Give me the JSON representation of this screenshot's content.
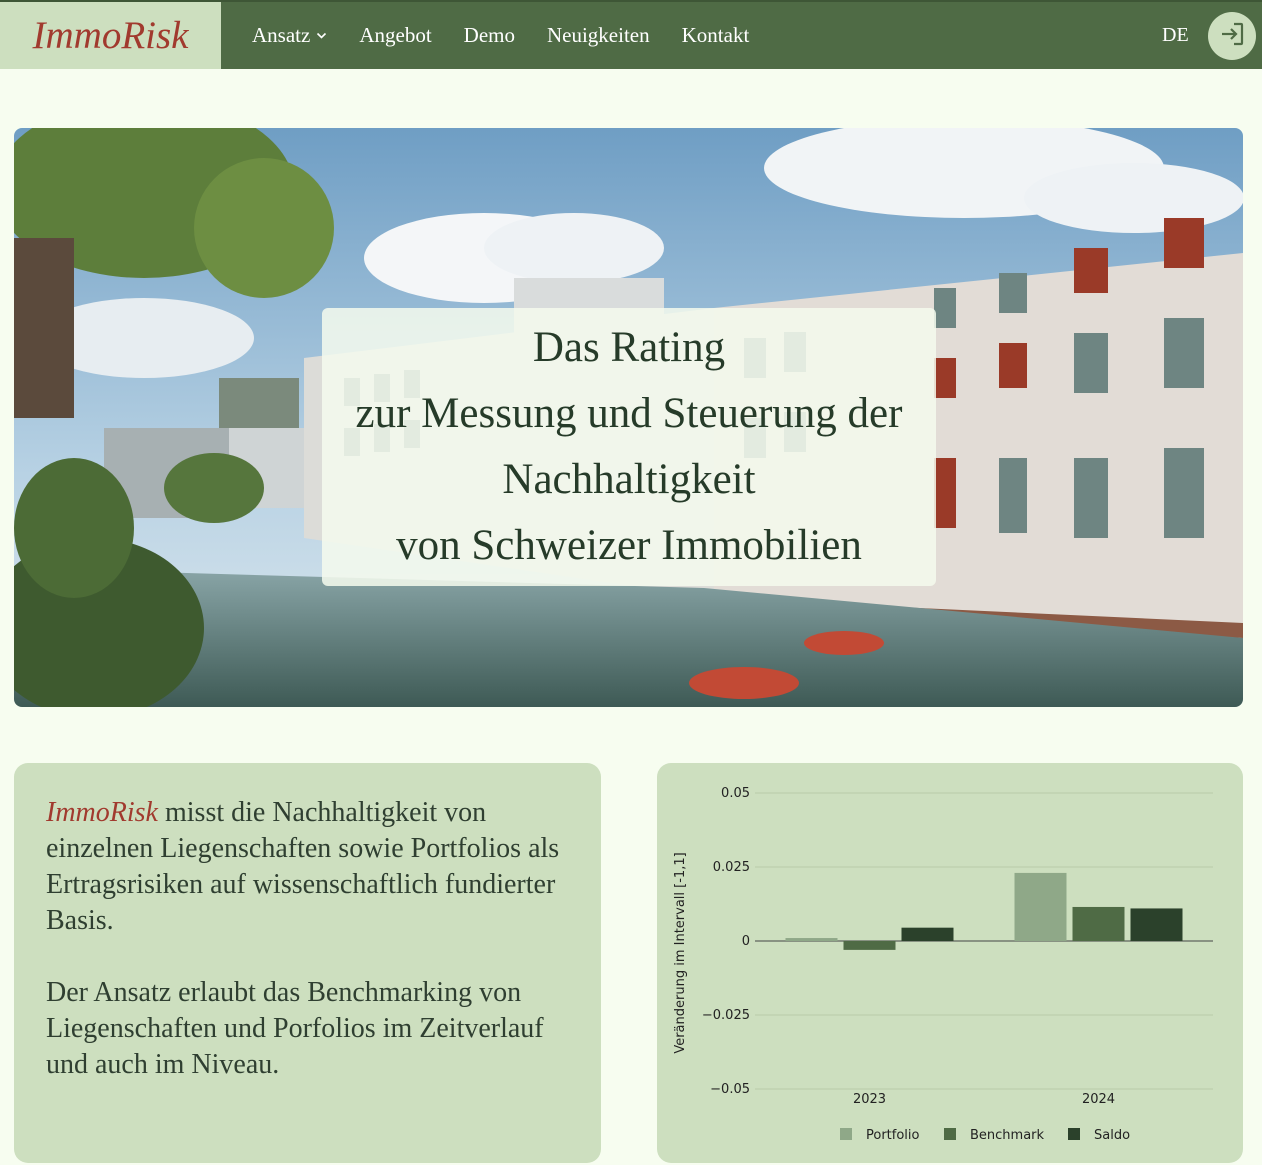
{
  "nav": {
    "brand": "ImmoRisk",
    "items": [
      "Ansatz",
      "Angebot",
      "Demo",
      "Neuigkeiten",
      "Kontakt"
    ],
    "language": "DE",
    "icons": {
      "dropdown": "chevron-down-icon",
      "login": "login-icon"
    }
  },
  "hero": {
    "lines": [
      "Das Rating",
      "zur Messung und Steuerung der",
      "Nachhaltigkeit",
      "von Schweizer Immobilien"
    ]
  },
  "intro": {
    "brand": "ImmoRisk",
    "p1_rest": "misst die Nachhaltigkeit von einzelnen Liegenschaften sowie Portfolios als Ertragsrisiken auf wissenschaftlich fundierter Basis.",
    "p2": "Der Ansatz erlaubt das Benchmarking von Liegenschaften und Porfolios im Zeitverlauf und auch im Niveau."
  },
  "colors": {
    "nav_bg": "#4f6b45",
    "brand_bg": "#cddfbf",
    "brand_text": "#a13a2e",
    "page_bg": "#f7fdf0",
    "card_bg": "#cddfbf"
  },
  "chart_data": {
    "type": "bar",
    "categories": [
      "2023",
      "2024"
    ],
    "series": [
      {
        "name": "Portfolio",
        "values": [
          0.001,
          0.023
        ],
        "color": "#8fa888"
      },
      {
        "name": "Benchmark",
        "values": [
          -0.003,
          0.0115
        ],
        "color": "#4f6b45"
      },
      {
        "name": "Saldo",
        "values": [
          0.0045,
          0.011
        ],
        "color": "#2b412b"
      }
    ],
    "ylabel": "Veränderung im Intervall [-1,1]",
    "ylim": [
      -0.05,
      0.05
    ],
    "yticks": [
      0.05,
      0.025,
      0,
      -0.025,
      -0.05
    ],
    "ytick_labels": [
      "0.05",
      "0.025",
      "0",
      "−0.025",
      "−0.05"
    ],
    "legend_position": "bottom",
    "grid": true
  }
}
